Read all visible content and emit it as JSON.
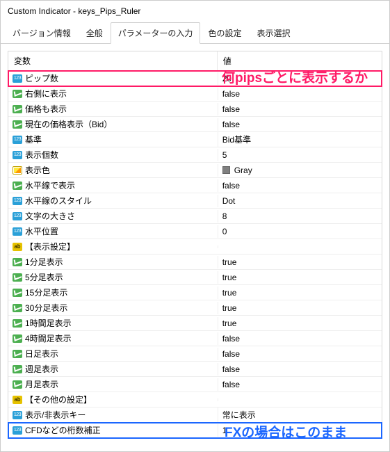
{
  "window": {
    "title": "Custom Indicator - keys_Pips_Ruler"
  },
  "tabs": {
    "version": "バージョン情報",
    "general": "全般",
    "params": "パラメーターの入力",
    "colors": "色の設定",
    "display": "表示選択"
  },
  "headers": {
    "name": "変数",
    "value": "値"
  },
  "rows": [
    {
      "icon": "int",
      "name": "ピップ数",
      "value": "20",
      "hl": "pink"
    },
    {
      "icon": "bool",
      "name": "右側に表示",
      "value": "false"
    },
    {
      "icon": "bool",
      "name": "価格も表示",
      "value": "false"
    },
    {
      "icon": "bool",
      "name": "現在の価格表示（Bid）",
      "value": "false"
    },
    {
      "icon": "int",
      "name": "基準",
      "value": "Bid基準"
    },
    {
      "icon": "int",
      "name": "表示個数",
      "value": "5"
    },
    {
      "icon": "color",
      "name": "表示色",
      "value": "Gray",
      "swatch": true
    },
    {
      "icon": "bool",
      "name": "水平線で表示",
      "value": "false"
    },
    {
      "icon": "int",
      "name": "水平線のスタイル",
      "value": "Dot"
    },
    {
      "icon": "int",
      "name": "文字の大きさ",
      "value": "8"
    },
    {
      "icon": "int",
      "name": "水平位置",
      "value": "0"
    },
    {
      "icon": "str",
      "name": "【表示設定】",
      "value": ""
    },
    {
      "icon": "bool",
      "name": "1分足表示",
      "value": "true"
    },
    {
      "icon": "bool",
      "name": "5分足表示",
      "value": "true"
    },
    {
      "icon": "bool",
      "name": "15分足表示",
      "value": "true"
    },
    {
      "icon": "bool",
      "name": "30分足表示",
      "value": "true"
    },
    {
      "icon": "bool",
      "name": "1時間足表示",
      "value": "true"
    },
    {
      "icon": "bool",
      "name": "4時間足表示",
      "value": "false"
    },
    {
      "icon": "bool",
      "name": "日足表示",
      "value": "false"
    },
    {
      "icon": "bool",
      "name": "週足表示",
      "value": "false"
    },
    {
      "icon": "bool",
      "name": "月足表示",
      "value": "false"
    },
    {
      "icon": "str",
      "name": "【その他の設定】",
      "value": ""
    },
    {
      "icon": "int",
      "name": "表示/非表示キー",
      "value": "常に表示"
    },
    {
      "icon": "int",
      "name": "CFDなどの桁数補正",
      "value": "1",
      "hl": "blue"
    }
  ],
  "annotations": {
    "pink": "何pipsごとに表示するか",
    "blue": "FXの場合はこのまま"
  }
}
